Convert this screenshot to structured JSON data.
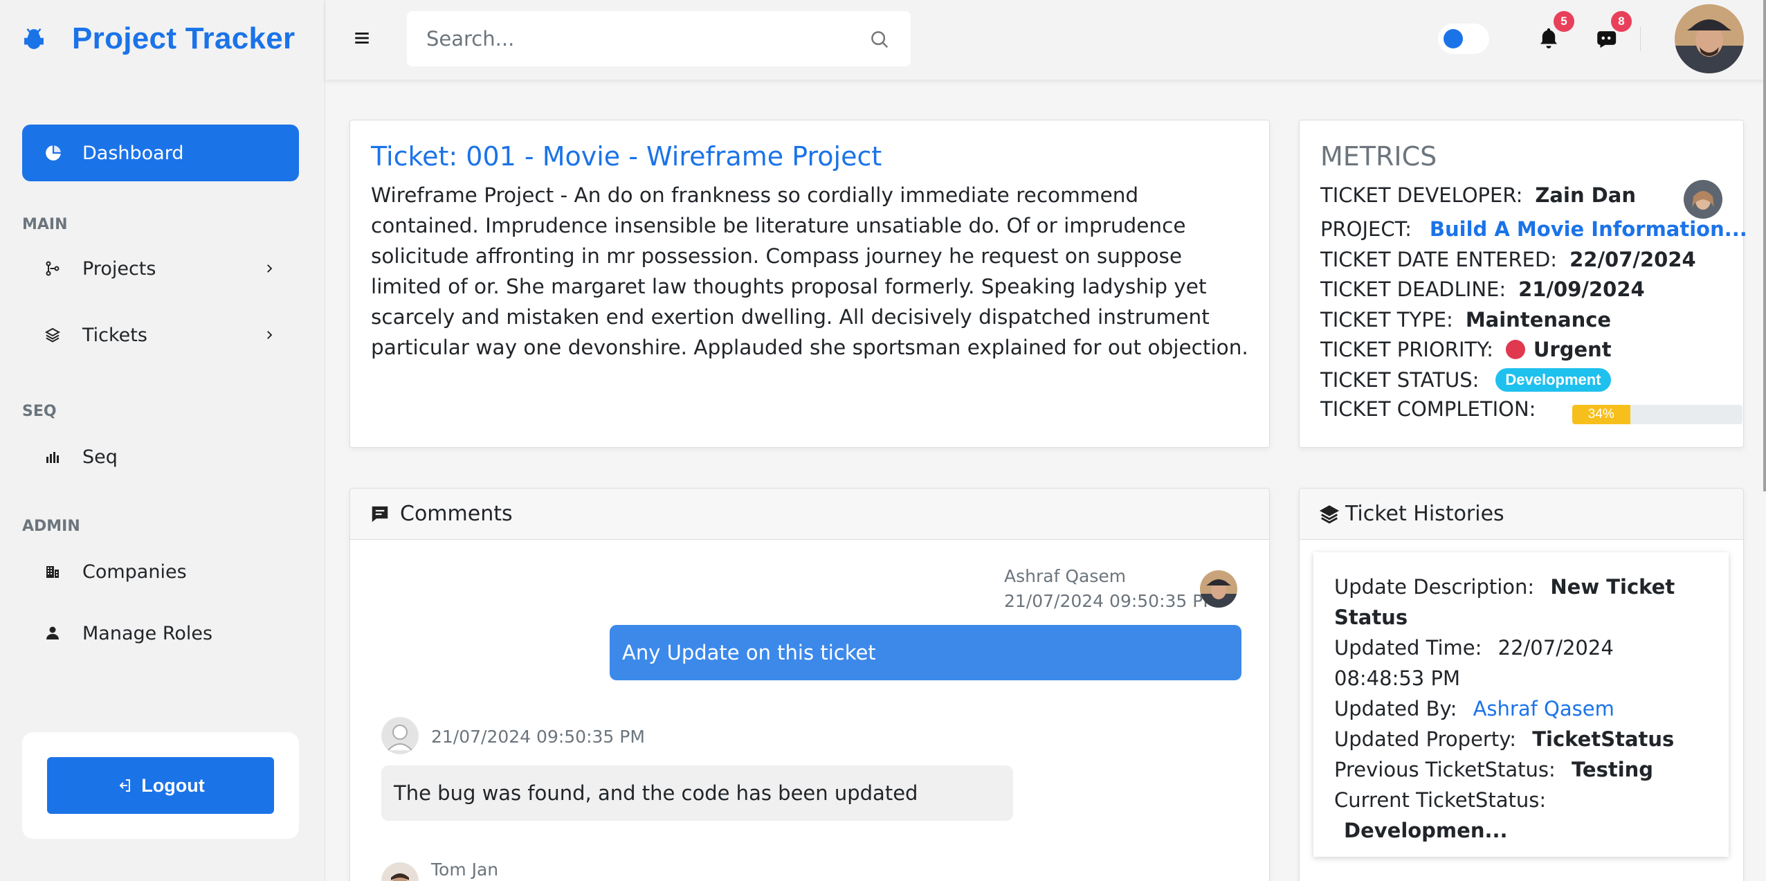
{
  "sidebar": {
    "brand": "Project Tracker",
    "dashboard_label": "Dashboard",
    "sections": {
      "main": "MAIN",
      "seq": "SEQ",
      "admin": "ADMIN"
    },
    "items": {
      "projects": "Projects",
      "tickets": "Tickets",
      "seq": "Seq",
      "companies": "Companies",
      "manage_roles": "Manage Roles"
    },
    "logout_label": "Logout"
  },
  "topbar": {
    "search_placeholder": "Search...",
    "notifications_count": "5",
    "messages_count": "8"
  },
  "ticket": {
    "title": "Ticket: 001 - Movie - Wireframe Project",
    "description": "Wireframe Project - An do on frankness so cordially immediate recommend contained. Imprudence insensible be literature unsatiable do. Of or imprudence solicitude affronting in mr possession. Compass journey he request on suppose limited of or. She margaret law thoughts proposal formerly. Speaking ladyship yet scarcely and mistaken end exertion dwelling. All decisively dispatched instrument particular way one devonshire. Applauded she sportsman explained for out objection."
  },
  "metrics": {
    "heading": "METRICS",
    "developer_label": "TICKET DEVELOPER:",
    "developer_value": "Zain Dan",
    "project_label": "PROJECT:",
    "project_value": "Build A Movie Information...",
    "date_entered_label": "TICKET DATE ENTERED:",
    "date_entered_value": "22/07/2024",
    "deadline_label": "TICKET DEADLINE:",
    "deadline_value": "21/09/2024",
    "type_label": "TICKET TYPE:",
    "type_value": "Maintenance",
    "priority_label": "TICKET PRIORITY:",
    "priority_value": "Urgent",
    "status_label": "TICKET STATUS:",
    "status_value": "Development",
    "completion_label": "TICKET COMPLETION:",
    "completion_text": "34%",
    "completion_fraction": 0.34,
    "colors": {
      "accent": "#1b73e8",
      "urgent": "#e0384e",
      "status": "#1ec0ee",
      "progress": "#f7bf1c"
    }
  },
  "comments": {
    "header": "Comments",
    "items": [
      {
        "author": "Ashraf Qasem",
        "time": "21/07/2024 09:50:35 PM",
        "text": "Any Update on this ticket"
      },
      {
        "author": "",
        "time": "21/07/2024 09:50:35 PM",
        "text": "The bug was found, and the code has been updated"
      },
      {
        "author": "Tom Jan"
      }
    ]
  },
  "history": {
    "header": "Ticket Histories",
    "update_description_label": "Update Description:",
    "update_description_value": "New Ticket Status",
    "updated_time_label": "Updated Time:",
    "updated_time_value": "22/07/2024 08:48:53 PM",
    "updated_by_label": "Updated By:",
    "updated_by_value": "Ashraf Qasem",
    "updated_property_label": "Updated Property:",
    "updated_property_value": "TicketStatus",
    "previous_label": "Previous TicketStatus:",
    "previous_value": "Testing",
    "current_label": "Current TicketStatus:",
    "current_value": "Developmen..."
  }
}
